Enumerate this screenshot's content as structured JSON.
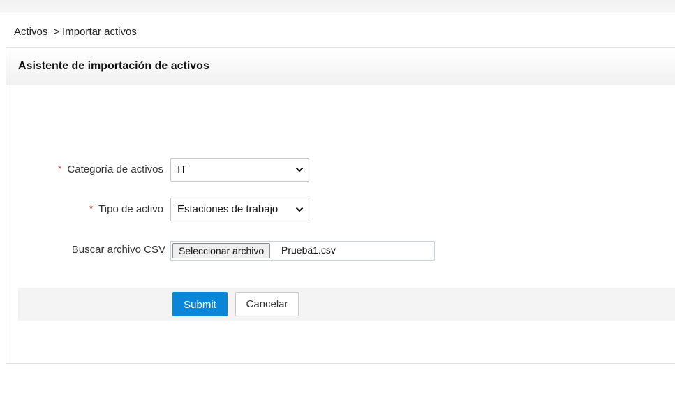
{
  "breadcrumb": {
    "parent": "Activos",
    "separator": ">",
    "current": "Importar activos"
  },
  "wizard": {
    "title": "Asistente de importación de activos"
  },
  "form": {
    "required_mark": "*",
    "category": {
      "label": "Categoría de activos",
      "selected": "IT"
    },
    "asset_type": {
      "label": "Tipo de activo",
      "selected": "Estaciones de trabajo"
    },
    "csv": {
      "label": "Buscar archivo CSV",
      "button_label": "Seleccionar archivo",
      "file_name": "Prueba1.csv"
    }
  },
  "actions": {
    "submit_label": "Submit",
    "cancel_label": "Cancelar"
  },
  "colors": {
    "submit_bg": "#0a86d9",
    "required": "#d9312b"
  },
  "icons": {
    "dropdown": "chevron-down-icon"
  }
}
